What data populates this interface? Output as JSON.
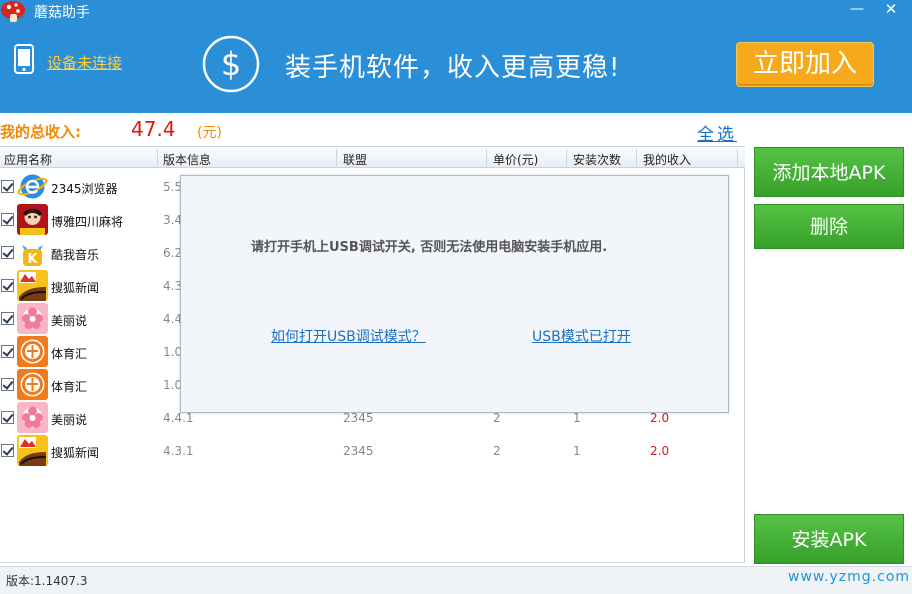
{
  "window": {
    "title": "蘑菇助手",
    "minimize_label": "—",
    "close_label": "✕"
  },
  "banner": {
    "device_status": "设备未连接",
    "slogan": "装手机软件，收入更高更稳!",
    "join_button": "立即加入",
    "dollar_symbol": "$"
  },
  "income": {
    "label": "我的总收入:",
    "value": "47.4",
    "unit": "(元)",
    "select_all": "全选"
  },
  "table": {
    "headers": [
      "应用名称",
      "版本信息",
      "联盟",
      "单价(元)",
      "安装次数",
      "我的收入"
    ],
    "rows": [
      {
        "name": "2345浏览器",
        "version": "5.5",
        "union": "",
        "price": "",
        "count": "",
        "income": "",
        "icon": "ie-e-icon"
      },
      {
        "name": "博雅四川麻将",
        "version": "3.4",
        "union": "",
        "price": "",
        "count": "",
        "income": "",
        "icon": "mahjong-icon"
      },
      {
        "name": "酷我音乐",
        "version": "6.2",
        "union": "",
        "price": "",
        "count": "",
        "income": "",
        "icon": "kuwo-icon"
      },
      {
        "name": "搜狐新闻",
        "version": "4.3",
        "union": "",
        "price": "",
        "count": "",
        "income": "",
        "icon": "sohu-icon"
      },
      {
        "name": "美丽说",
        "version": "4.4",
        "union": "",
        "price": "",
        "count": "",
        "income": "",
        "icon": "meilishuo-icon"
      },
      {
        "name": "体育汇",
        "version": "1.0",
        "union": "",
        "price": "",
        "count": "",
        "income": "",
        "icon": "tiyuhui-icon"
      },
      {
        "name": "体育汇",
        "version": "1.0",
        "union": "",
        "price": "",
        "count": "",
        "income": "",
        "icon": "tiyuhui-icon"
      },
      {
        "name": "美丽说",
        "version": "4.4.1",
        "union": "2345",
        "price": "2",
        "count": "1",
        "income": "2.0",
        "icon": "meilishuo-icon"
      },
      {
        "name": "搜狐新闻",
        "version": "4.3.1",
        "union": "2345",
        "price": "2",
        "count": "1",
        "income": "2.0",
        "icon": "sohu-icon"
      }
    ]
  },
  "modal": {
    "message": "请打开手机上USB调试开关, 否则无法使用电脑安装手机应用.",
    "link_how": "如何打开USB调试模式？",
    "link_opened": "USB模式已打开"
  },
  "actions": {
    "add_local_apk": "添加本地APK",
    "delete": "删除",
    "install_apk": "安装APK"
  },
  "status": {
    "version": "版本:1.1407.3",
    "site": "www.yzmg.com"
  },
  "colors": {
    "header_blue": "#2b8fd8",
    "accent_orange": "#f7a91c",
    "action_green": "#3fae30",
    "income_red": "#e01515"
  }
}
